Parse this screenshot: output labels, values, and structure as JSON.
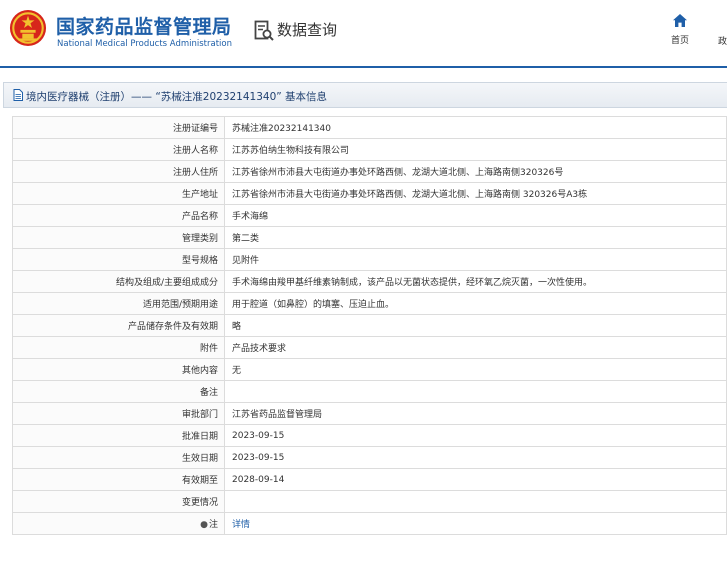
{
  "header": {
    "org_name_cn": "国家药品监督管理局",
    "org_name_en": "National Medical Products Administration",
    "section_title": "数据查询",
    "nav": {
      "home_label": "首页",
      "next_label_partial": "政"
    }
  },
  "title_bar": {
    "text": "境内医疗器械（注册）——  “苏械注准20232141340” 基本信息"
  },
  "details": {
    "rows": [
      {
        "label": "注册证编号",
        "value": "苏械注准20232141340"
      },
      {
        "label": "注册人名称",
        "value": "江苏苏伯纳生物科技有限公司"
      },
      {
        "label": "注册人住所",
        "value": "江苏省徐州市沛县大屯街道办事处环路西侧、龙湖大道北侧、上海路南侧320326号"
      },
      {
        "label": "生产地址",
        "value": "江苏省徐州市沛县大屯街道办事处环路西侧、龙湖大道北侧、上海路南侧 320326号A3栋"
      },
      {
        "label": "产品名称",
        "value": "手术海绵"
      },
      {
        "label": "管理类别",
        "value": "第二类"
      },
      {
        "label": "型号规格",
        "value": "见附件"
      },
      {
        "label": "结构及组成/主要组成成分",
        "value": "手术海绵由羧甲基纤维素钠制成，该产品以无菌状态提供，经环氧乙烷灭菌，一次性使用。"
      },
      {
        "label": "适用范围/预期用途",
        "value": "用于腔道（如鼻腔）的填塞、压迫止血。"
      },
      {
        "label": "产品储存条件及有效期",
        "value": "略"
      },
      {
        "label": "附件",
        "value": "产品技术要求"
      },
      {
        "label": "其他内容",
        "value": "无"
      },
      {
        "label": "备注",
        "value": ""
      },
      {
        "label": "审批部门",
        "value": "江苏省药品监督管理局"
      },
      {
        "label": "批准日期",
        "value": "2023-09-15"
      },
      {
        "label": "生效日期",
        "value": "2023-09-15"
      },
      {
        "label": "有效期至",
        "value": "2028-09-14"
      },
      {
        "label": "变更情况",
        "value": ""
      }
    ],
    "note_row": {
      "label": "注",
      "value": "详情"
    }
  },
  "icons": {
    "emblem": "national-emblem-icon",
    "query": "document-search-icon",
    "home": "home-icon",
    "title": "document-icon",
    "note": "pin-icon"
  },
  "colors": {
    "brand": "#1f5fa8",
    "emblem_red": "#d7261b",
    "emblem_gold": "#f2c12e"
  }
}
